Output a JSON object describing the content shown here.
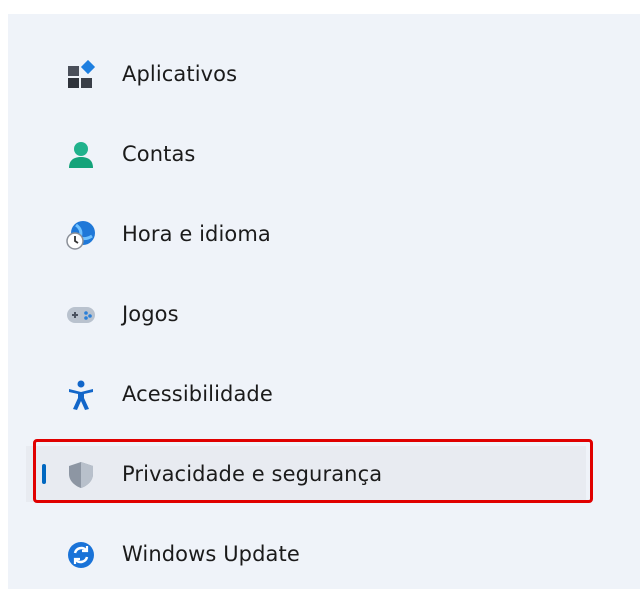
{
  "nav": {
    "items": [
      {
        "label": "Aplicativos",
        "icon": "apps-icon"
      },
      {
        "label": "Contas",
        "icon": "account-icon"
      },
      {
        "label": "Hora e idioma",
        "icon": "time-language-icon"
      },
      {
        "label": "Jogos",
        "icon": "gamepad-icon"
      },
      {
        "label": "Acessibilidade",
        "icon": "accessibility-icon"
      },
      {
        "label": "Privacidade e segurança",
        "icon": "shield-icon",
        "selected": true
      },
      {
        "label": "Windows Update",
        "icon": "update-icon"
      }
    ]
  },
  "colors": {
    "accent": "#0067c0",
    "highlight_border": "#e00000",
    "panel_background": "#eff3f9"
  }
}
